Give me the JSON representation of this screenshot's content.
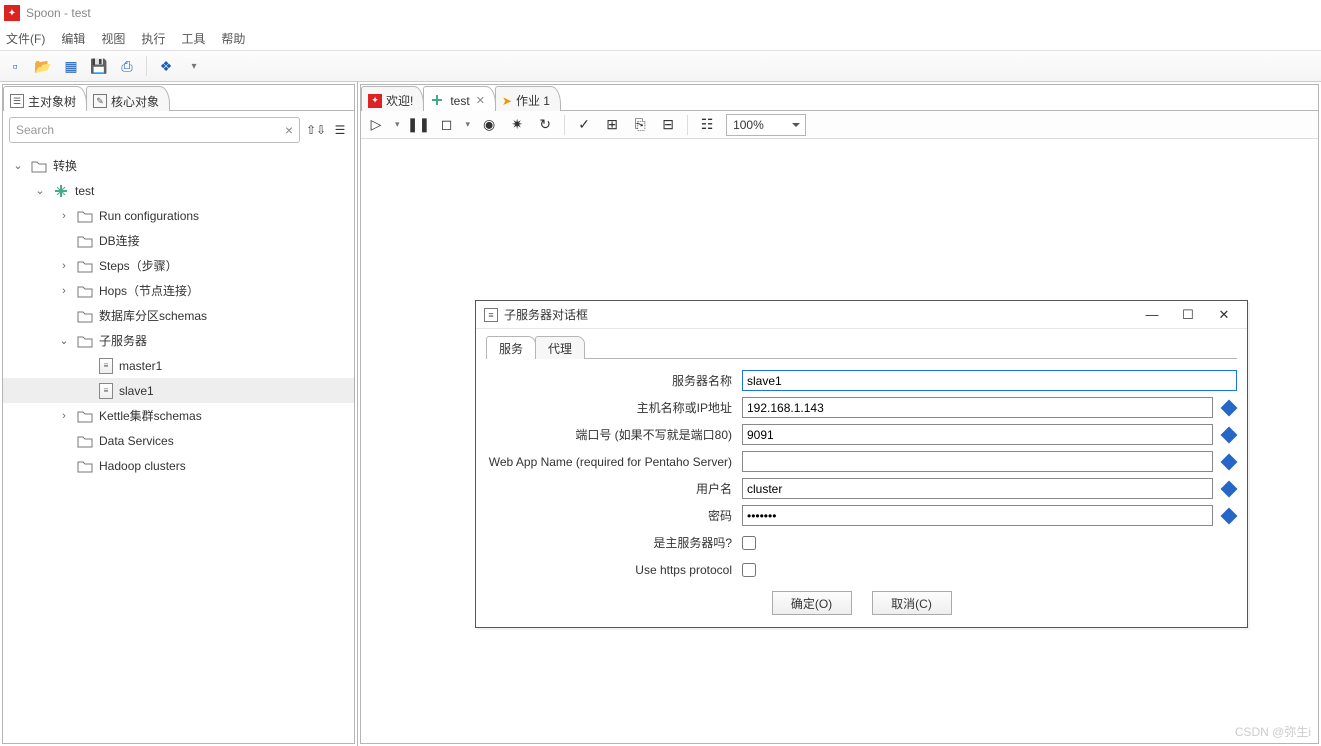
{
  "window": {
    "title": "Spoon - test"
  },
  "menu": [
    "文件(F)",
    "编辑",
    "视图",
    "执行",
    "工具",
    "帮助"
  ],
  "left_tabs": [
    "主对象树",
    "核心对象"
  ],
  "search": {
    "placeholder": "Search"
  },
  "tree": {
    "root": "转换",
    "transform": "test",
    "nodes": [
      "Run configurations",
      "DB连接",
      "Steps（步骤）",
      "Hops（节点连接）",
      "数据库分区schemas"
    ],
    "subserver": "子服务器",
    "sub_items": [
      "master1",
      "slave1"
    ],
    "tail": [
      "Kettle集群schemas",
      "Data Services",
      "Hadoop clusters"
    ]
  },
  "editor_tabs": [
    {
      "label": "欢迎!",
      "icon": "welcome"
    },
    {
      "label": "test",
      "icon": "transform",
      "closable": true,
      "active": true
    },
    {
      "label": "作业 1",
      "icon": "job"
    }
  ],
  "zoom": "100%",
  "dialog": {
    "title": "子服务器对话框",
    "tabs": [
      "服务",
      "代理"
    ],
    "labels": {
      "name": "服务器名称",
      "host": "主机名称或IP地址",
      "port": "端口号 (如果不写就是端口80)",
      "webapp": "Web App Name (required for Pentaho Server)",
      "user": "用户名",
      "pass": "密码",
      "isMaster": "是主服务器吗?",
      "https": "Use https protocol"
    },
    "values": {
      "name": "slave1",
      "host": "192.168.1.143",
      "port": "9091",
      "webapp": "",
      "user": "cluster",
      "pass": "•••••••"
    },
    "buttons": {
      "ok": "确定(O)",
      "cancel": "取消(C)"
    }
  },
  "watermark": "CSDN @弥生i"
}
